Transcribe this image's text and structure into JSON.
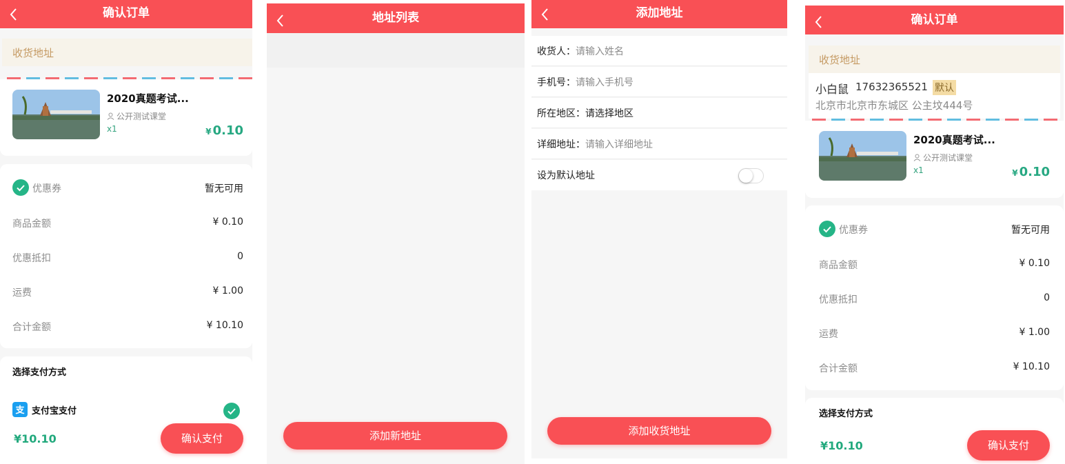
{
  "colors": {
    "primary": "#f95055",
    "green": "#25b587",
    "address_bg": "#f7f3ea",
    "address_text": "#c59a63"
  },
  "icons": {
    "back": "chevron-left-icon",
    "check": "check-circle-icon",
    "user": "user-icon",
    "alipay": "alipay-icon",
    "thumbnail": "landscape-image"
  },
  "checkout": {
    "title": "确认订单",
    "address_section": "收货地址",
    "product": {
      "title": "2020真题考试...",
      "teacher": "公开测试课堂",
      "qty": "x1",
      "currency": "¥",
      "price": "0.10"
    },
    "coupon": {
      "label": "优惠券",
      "value": "暂无可用"
    },
    "summary": [
      {
        "label": "商品金额",
        "value": "¥ 0.10"
      },
      {
        "label": "优惠抵扣",
        "value": "0"
      },
      {
        "label": "运费",
        "value": "¥ 1.00"
      },
      {
        "label": "合计金额",
        "value": "¥ 10.10"
      }
    ],
    "payment_title": "选择支付方式",
    "payment_method": "支付宝支付",
    "total": "¥10.10",
    "confirm_button": "确认支付"
  },
  "address_list": {
    "title": "地址列表",
    "add_button": "添加新地址"
  },
  "add_address": {
    "title": "添加地址",
    "fields": [
      {
        "label": "收货人：",
        "placeholder": "请输入姓名"
      },
      {
        "label": "手机号：",
        "placeholder": "请输入手机号"
      },
      {
        "label": "所在地区：",
        "value": "请选择地区"
      },
      {
        "label": "详细地址：",
        "placeholder": "请输入详细地址"
      }
    ],
    "default_label": "设为默认地址",
    "default_on": false,
    "submit_button": "添加收货地址"
  },
  "checkout_filled": {
    "title": "确认订单",
    "address_section": "收货地址",
    "contact": {
      "name": "小白鼠",
      "phone": "17632365521",
      "badge": "默认",
      "address": "北京市北京市东城区 公主坟444号"
    },
    "product": {
      "title": "2020真题考试...",
      "teacher": "公开测试课堂",
      "qty": "x1",
      "currency": "¥",
      "price": "0.10"
    },
    "coupon": {
      "label": "优惠券",
      "value": "暂无可用"
    },
    "summary": [
      {
        "label": "商品金额",
        "value": "¥ 0.10"
      },
      {
        "label": "优惠抵扣",
        "value": "0"
      },
      {
        "label": "运费",
        "value": "¥ 1.00"
      },
      {
        "label": "合计金额",
        "value": "¥ 10.10"
      }
    ],
    "payment_title": "选择支付方式",
    "total": "¥10.10",
    "confirm_button": "确认支付"
  }
}
